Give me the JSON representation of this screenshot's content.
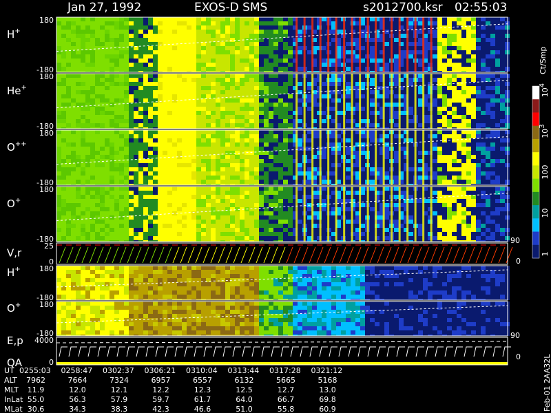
{
  "header": {
    "date": "Jan 27, 1992",
    "instrument": "EXOS-D SMS",
    "file": "s2012700.ksr",
    "time": "02:55:03"
  },
  "colorbar": {
    "unit": "Ct/Smp",
    "ticks": [
      {
        "label": "10",
        "sup": "4",
        "value": 10000
      },
      {
        "label": "10",
        "sup": "3",
        "value": 1000
      },
      {
        "label": "100",
        "sup": "",
        "value": 100
      },
      {
        "label": "10",
        "sup": "",
        "value": 10
      },
      {
        "label": "1",
        "sup": "",
        "value": 1
      }
    ],
    "colors": [
      "#ffffff",
      "#8b1a1a",
      "#ff0000",
      "#8b6914",
      "#b8a000",
      "#ffff00",
      "#c8e600",
      "#7fdf00",
      "#228b22",
      "#00a0a0",
      "#00bfff",
      "#1e3cc8",
      "#0a1a6e"
    ]
  },
  "side_labels": {
    "aux_90_a": "90",
    "aux_0_a": "0",
    "aux_90_b": "90",
    "aux_0_b": "0"
  },
  "footer": {
    "code": "Feb-01 2AA32L"
  },
  "chart_data": {
    "type": "heatmap",
    "panels": [
      {
        "id": "H+ angle",
        "label": "H",
        "sup": "+",
        "ylim": [
          -180,
          180
        ],
        "yticks": [
          "180",
          "-180"
        ]
      },
      {
        "id": "He+ angle",
        "label": "He",
        "sup": "+",
        "ylim": [
          -180,
          180
        ],
        "yticks": [
          "180",
          "-180"
        ]
      },
      {
        "id": "O++ angle",
        "label": "O",
        "sup": "++",
        "ylim": [
          -180,
          180
        ],
        "yticks": [
          "180",
          "-180"
        ]
      },
      {
        "id": "O+ angle",
        "label": "O",
        "sup": "+",
        "ylim": [
          -180,
          180
        ],
        "yticks": [
          "180",
          "-180"
        ]
      },
      {
        "id": "V,r",
        "label": "V,r",
        "sup": "",
        "ylim": [
          0,
          25
        ],
        "yticks": [
          "25",
          "0"
        ]
      },
      {
        "id": "H+ lower",
        "label": "H",
        "sup": "+",
        "ylim": [
          -180,
          180
        ],
        "yticks": [
          "180",
          "-180"
        ]
      },
      {
        "id": "O+ lower",
        "label": "O",
        "sup": "+",
        "ylim": [
          -180,
          180
        ],
        "yticks": [
          "180",
          "-180"
        ]
      },
      {
        "id": "E,p QA",
        "label": "E,p",
        "label2": "QA",
        "sup": "",
        "ylim": [
          0,
          4000
        ],
        "yticks": [
          "4000",
          "0"
        ]
      }
    ],
    "colorscale": {
      "min": 1,
      "max": 10000,
      "log": true
    },
    "xaxis": {
      "label": "UT",
      "ticks": [
        "0255:03",
        "0258:47",
        "0302:37",
        "0306:21",
        "0310:04",
        "0313:44",
        "0317:28",
        "0321:12"
      ]
    },
    "ephemeris": [
      {
        "name": "ALT",
        "values": [
          "7962",
          "7664",
          "7324",
          "6957",
          "6557",
          "6132",
          "5665",
          "5168"
        ]
      },
      {
        "name": "MLT",
        "values": [
          "11.9",
          "12.0",
          "12.1",
          "12.2",
          "12.3",
          "12.5",
          "12.7",
          "13.0"
        ]
      },
      {
        "name": "InLat",
        "values": [
          "55.0",
          "56.3",
          "57.9",
          "59.7",
          "61.7",
          "64.0",
          "66.7",
          "69.8"
        ]
      },
      {
        "name": "MLat",
        "values": [
          "30.6",
          "34.3",
          "38.3",
          "42.3",
          "46.6",
          "51.0",
          "55.8",
          "60.9"
        ]
      }
    ]
  }
}
